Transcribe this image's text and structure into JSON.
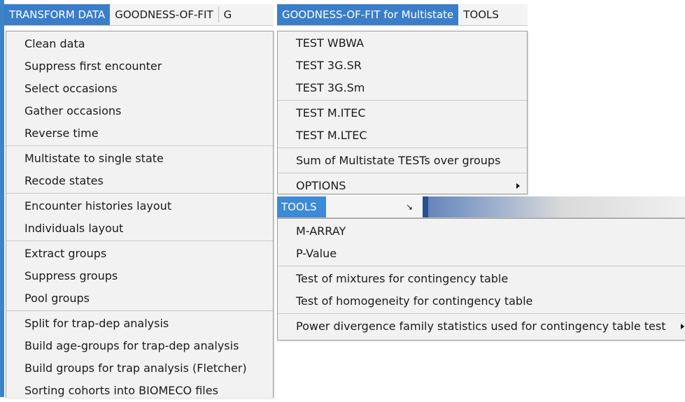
{
  "menubar_left": {
    "items": [
      {
        "label": "TRANSFORM DATA",
        "active": true
      },
      {
        "label": "GOODNESS-OF-FIT",
        "active": false
      },
      {
        "label": "G",
        "active": false
      }
    ]
  },
  "menubar_right": {
    "items": [
      {
        "label": "GOODNESS-OF-FIT for Multistate",
        "active": true
      },
      {
        "label": "TOOLS",
        "active": false
      }
    ]
  },
  "transform_menu": {
    "items": [
      "Clean data",
      "Suppress first encounter",
      "Select occasions",
      "Gather occasions",
      "Reverse time",
      "Multistate to single state",
      "Recode states",
      "Encounter histories layout",
      "Individuals layout",
      "Extract groups",
      "Suppress groups",
      "Pool groups",
      "Split for trap-dep analysis",
      "Build age-groups for trap-dep analysis",
      "Build groups for trap analysis (Fletcher)",
      "Sorting cohorts into BIOMECO files"
    ]
  },
  "gof_multistate_menu": {
    "items": [
      "TEST WBWA",
      "TEST 3G.SR",
      "TEST 3G.Sm",
      "TEST M.ITEC",
      "TEST M.LTEC",
      "Sum of Multistate TESTs over groups",
      "OPTIONS"
    ]
  },
  "tools_bar": {
    "label": "TOOLS",
    "dropdown_glyph": "↘"
  },
  "tools_menu": {
    "items": [
      "M-ARRAY",
      "P-Value",
      "Test of mixtures for contingency table",
      "Test of homogeneity for contingency table",
      "Power divergence family statistics used for contingency table test"
    ]
  },
  "colors": {
    "accent": "#3a7ec9",
    "menu_bg": "#f2f2f2",
    "frame": "#3c83c7"
  }
}
